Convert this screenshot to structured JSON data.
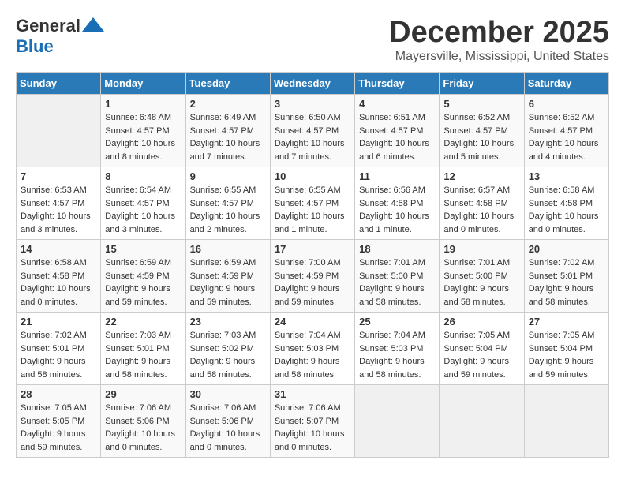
{
  "header": {
    "logo_text_general": "General",
    "logo_text_blue": "Blue",
    "month": "December 2025",
    "location": "Mayersville, Mississippi, United States"
  },
  "calendar": {
    "days_of_week": [
      "Sunday",
      "Monday",
      "Tuesday",
      "Wednesday",
      "Thursday",
      "Friday",
      "Saturday"
    ],
    "weeks": [
      [
        {
          "day": "",
          "sunrise": "",
          "sunset": "",
          "daylight": "",
          "empty": true
        },
        {
          "day": "1",
          "sunrise": "Sunrise: 6:48 AM",
          "sunset": "Sunset: 4:57 PM",
          "daylight": "Daylight: 10 hours and 8 minutes."
        },
        {
          "day": "2",
          "sunrise": "Sunrise: 6:49 AM",
          "sunset": "Sunset: 4:57 PM",
          "daylight": "Daylight: 10 hours and 7 minutes."
        },
        {
          "day": "3",
          "sunrise": "Sunrise: 6:50 AM",
          "sunset": "Sunset: 4:57 PM",
          "daylight": "Daylight: 10 hours and 7 minutes."
        },
        {
          "day": "4",
          "sunrise": "Sunrise: 6:51 AM",
          "sunset": "Sunset: 4:57 PM",
          "daylight": "Daylight: 10 hours and 6 minutes."
        },
        {
          "day": "5",
          "sunrise": "Sunrise: 6:52 AM",
          "sunset": "Sunset: 4:57 PM",
          "daylight": "Daylight: 10 hours and 5 minutes."
        },
        {
          "day": "6",
          "sunrise": "Sunrise: 6:52 AM",
          "sunset": "Sunset: 4:57 PM",
          "daylight": "Daylight: 10 hours and 4 minutes."
        }
      ],
      [
        {
          "day": "7",
          "sunrise": "Sunrise: 6:53 AM",
          "sunset": "Sunset: 4:57 PM",
          "daylight": "Daylight: 10 hours and 3 minutes."
        },
        {
          "day": "8",
          "sunrise": "Sunrise: 6:54 AM",
          "sunset": "Sunset: 4:57 PM",
          "daylight": "Daylight: 10 hours and 3 minutes."
        },
        {
          "day": "9",
          "sunrise": "Sunrise: 6:55 AM",
          "sunset": "Sunset: 4:57 PM",
          "daylight": "Daylight: 10 hours and 2 minutes."
        },
        {
          "day": "10",
          "sunrise": "Sunrise: 6:55 AM",
          "sunset": "Sunset: 4:57 PM",
          "daylight": "Daylight: 10 hours and 1 minute."
        },
        {
          "day": "11",
          "sunrise": "Sunrise: 6:56 AM",
          "sunset": "Sunset: 4:58 PM",
          "daylight": "Daylight: 10 hours and 1 minute."
        },
        {
          "day": "12",
          "sunrise": "Sunrise: 6:57 AM",
          "sunset": "Sunset: 4:58 PM",
          "daylight": "Daylight: 10 hours and 0 minutes."
        },
        {
          "day": "13",
          "sunrise": "Sunrise: 6:58 AM",
          "sunset": "Sunset: 4:58 PM",
          "daylight": "Daylight: 10 hours and 0 minutes."
        }
      ],
      [
        {
          "day": "14",
          "sunrise": "Sunrise: 6:58 AM",
          "sunset": "Sunset: 4:58 PM",
          "daylight": "Daylight: 10 hours and 0 minutes."
        },
        {
          "day": "15",
          "sunrise": "Sunrise: 6:59 AM",
          "sunset": "Sunset: 4:59 PM",
          "daylight": "Daylight: 9 hours and 59 minutes."
        },
        {
          "day": "16",
          "sunrise": "Sunrise: 6:59 AM",
          "sunset": "Sunset: 4:59 PM",
          "daylight": "Daylight: 9 hours and 59 minutes."
        },
        {
          "day": "17",
          "sunrise": "Sunrise: 7:00 AM",
          "sunset": "Sunset: 4:59 PM",
          "daylight": "Daylight: 9 hours and 59 minutes."
        },
        {
          "day": "18",
          "sunrise": "Sunrise: 7:01 AM",
          "sunset": "Sunset: 5:00 PM",
          "daylight": "Daylight: 9 hours and 58 minutes."
        },
        {
          "day": "19",
          "sunrise": "Sunrise: 7:01 AM",
          "sunset": "Sunset: 5:00 PM",
          "daylight": "Daylight: 9 hours and 58 minutes."
        },
        {
          "day": "20",
          "sunrise": "Sunrise: 7:02 AM",
          "sunset": "Sunset: 5:01 PM",
          "daylight": "Daylight: 9 hours and 58 minutes."
        }
      ],
      [
        {
          "day": "21",
          "sunrise": "Sunrise: 7:02 AM",
          "sunset": "Sunset: 5:01 PM",
          "daylight": "Daylight: 9 hours and 58 minutes."
        },
        {
          "day": "22",
          "sunrise": "Sunrise: 7:03 AM",
          "sunset": "Sunset: 5:01 PM",
          "daylight": "Daylight: 9 hours and 58 minutes."
        },
        {
          "day": "23",
          "sunrise": "Sunrise: 7:03 AM",
          "sunset": "Sunset: 5:02 PM",
          "daylight": "Daylight: 9 hours and 58 minutes."
        },
        {
          "day": "24",
          "sunrise": "Sunrise: 7:04 AM",
          "sunset": "Sunset: 5:03 PM",
          "daylight": "Daylight: 9 hours and 58 minutes."
        },
        {
          "day": "25",
          "sunrise": "Sunrise: 7:04 AM",
          "sunset": "Sunset: 5:03 PM",
          "daylight": "Daylight: 9 hours and 58 minutes."
        },
        {
          "day": "26",
          "sunrise": "Sunrise: 7:05 AM",
          "sunset": "Sunset: 5:04 PM",
          "daylight": "Daylight: 9 hours and 59 minutes."
        },
        {
          "day": "27",
          "sunrise": "Sunrise: 7:05 AM",
          "sunset": "Sunset: 5:04 PM",
          "daylight": "Daylight: 9 hours and 59 minutes."
        }
      ],
      [
        {
          "day": "28",
          "sunrise": "Sunrise: 7:05 AM",
          "sunset": "Sunset: 5:05 PM",
          "daylight": "Daylight: 9 hours and 59 minutes."
        },
        {
          "day": "29",
          "sunrise": "Sunrise: 7:06 AM",
          "sunset": "Sunset: 5:06 PM",
          "daylight": "Daylight: 10 hours and 0 minutes."
        },
        {
          "day": "30",
          "sunrise": "Sunrise: 7:06 AM",
          "sunset": "Sunset: 5:06 PM",
          "daylight": "Daylight: 10 hours and 0 minutes."
        },
        {
          "day": "31",
          "sunrise": "Sunrise: 7:06 AM",
          "sunset": "Sunset: 5:07 PM",
          "daylight": "Daylight: 10 hours and 0 minutes."
        },
        {
          "day": "",
          "sunrise": "",
          "sunset": "",
          "daylight": "",
          "empty": true
        },
        {
          "day": "",
          "sunrise": "",
          "sunset": "",
          "daylight": "",
          "empty": true
        },
        {
          "day": "",
          "sunrise": "",
          "sunset": "",
          "daylight": "",
          "empty": true
        }
      ]
    ]
  }
}
